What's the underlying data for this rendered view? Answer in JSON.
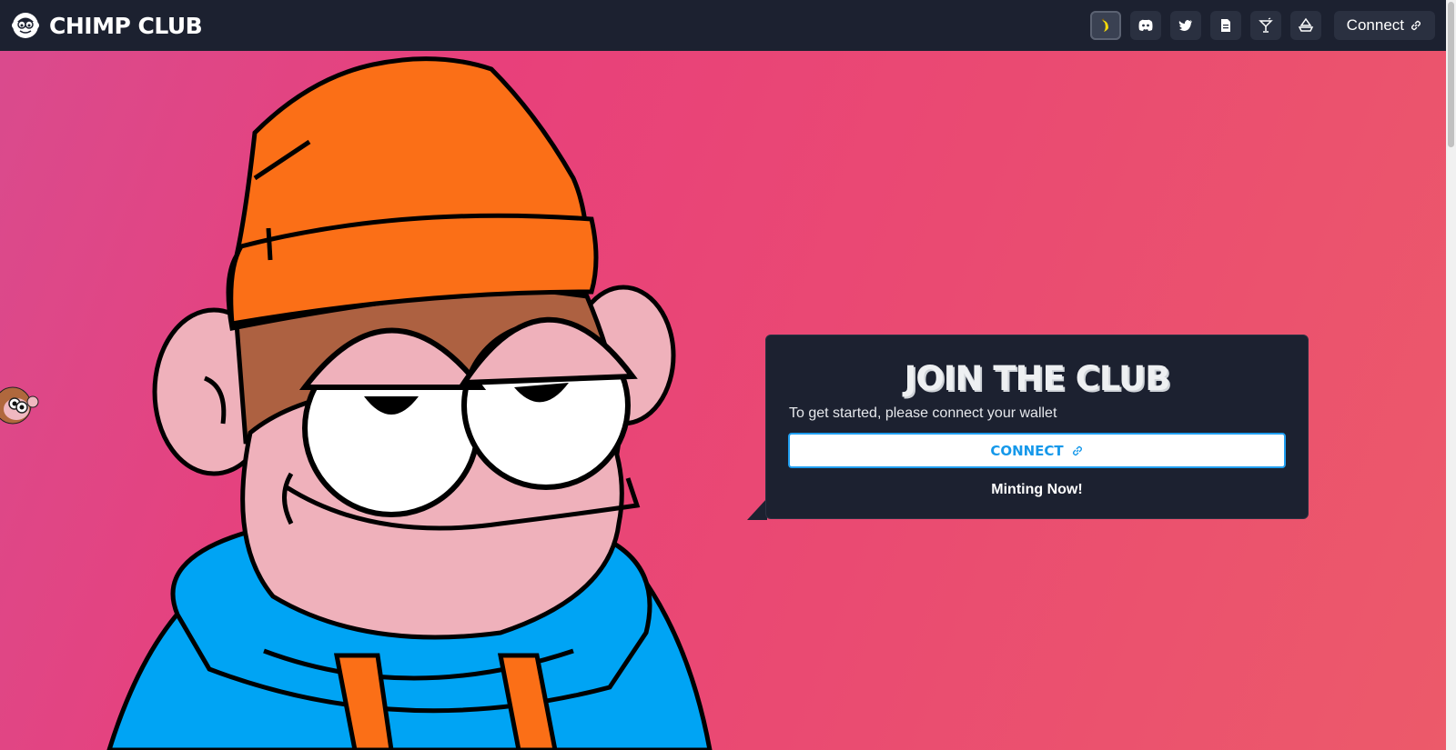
{
  "header": {
    "brand_name": "CHIMP CLUB",
    "nav_icons": [
      "banana-icon",
      "discord-icon",
      "twitter-icon",
      "document-icon",
      "cocktail-icon",
      "opensea-icon"
    ],
    "connect_label": "Connect"
  },
  "card": {
    "title": "JOIN THE CLUB",
    "subtitle": "To get started, please connect your wallet",
    "connect_label": "CONNECT",
    "status": "Minting Now!"
  },
  "colors": {
    "navbar": "#1c2130",
    "accent": "#1598ea",
    "background_start": "#d94b8e",
    "background_end": "#ec5a6a"
  }
}
